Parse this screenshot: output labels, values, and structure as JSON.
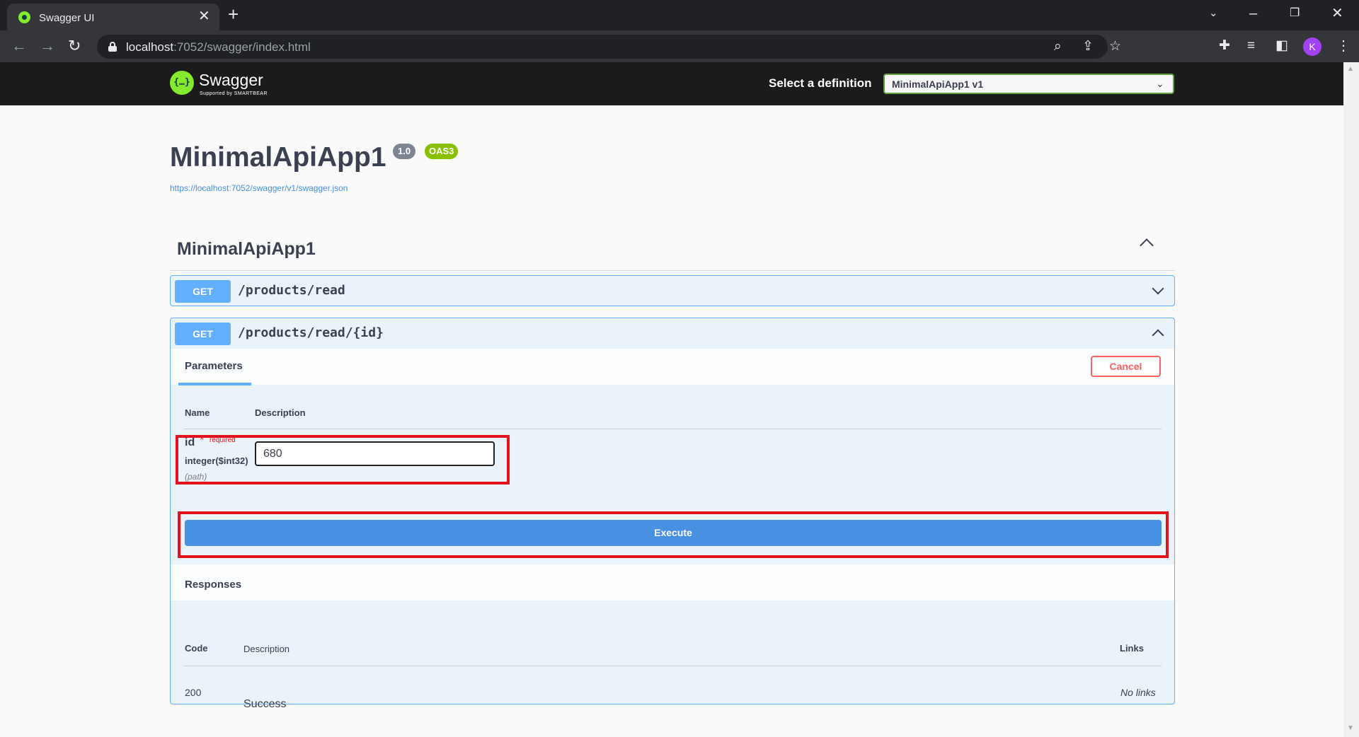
{
  "browser": {
    "tab_title": "Swagger UI",
    "tab_close": "✕",
    "new_tab": "+",
    "url_host": "localhost",
    "url_rest": ":7052/swagger/index.html",
    "profile_initial": "K"
  },
  "swagger_bar": {
    "logo_mark": "{…}",
    "logo_title": "Swagger",
    "logo_subtitle": "Supported by SMARTBEAR",
    "select_label": "Select a definition",
    "selected_definition": "MinimalApiApp1 v1"
  },
  "info": {
    "title": "MinimalApiApp1",
    "version": "1.0",
    "oas": "OAS3",
    "spec_url": "https://localhost:7052/swagger/v1/swagger.json"
  },
  "tag": {
    "name": "MinimalApiApp1"
  },
  "operations": [
    {
      "method": "GET",
      "path": "/products/read"
    },
    {
      "method": "GET",
      "path": "/products/read/{id}"
    }
  ],
  "parameters_panel": {
    "tab_label": "Parameters",
    "cancel_label": "Cancel",
    "col_name": "Name",
    "col_description": "Description",
    "param": {
      "name": "id",
      "required_star": "*",
      "required_label": "required",
      "type": "integer($int32)",
      "location": "(path)",
      "value": "680"
    },
    "execute_label": "Execute"
  },
  "responses": {
    "title": "Responses",
    "col_code": "Code",
    "col_description": "Description",
    "col_links": "Links",
    "rows": [
      {
        "code": "200",
        "description": "Success",
        "links": "No links"
      }
    ]
  },
  "colors": {
    "get_method": "#61affe",
    "execute": "#4990e2",
    "cancel": "#ff6060",
    "swagger_green": "#85ea2d",
    "highlight": "#e3131d"
  }
}
